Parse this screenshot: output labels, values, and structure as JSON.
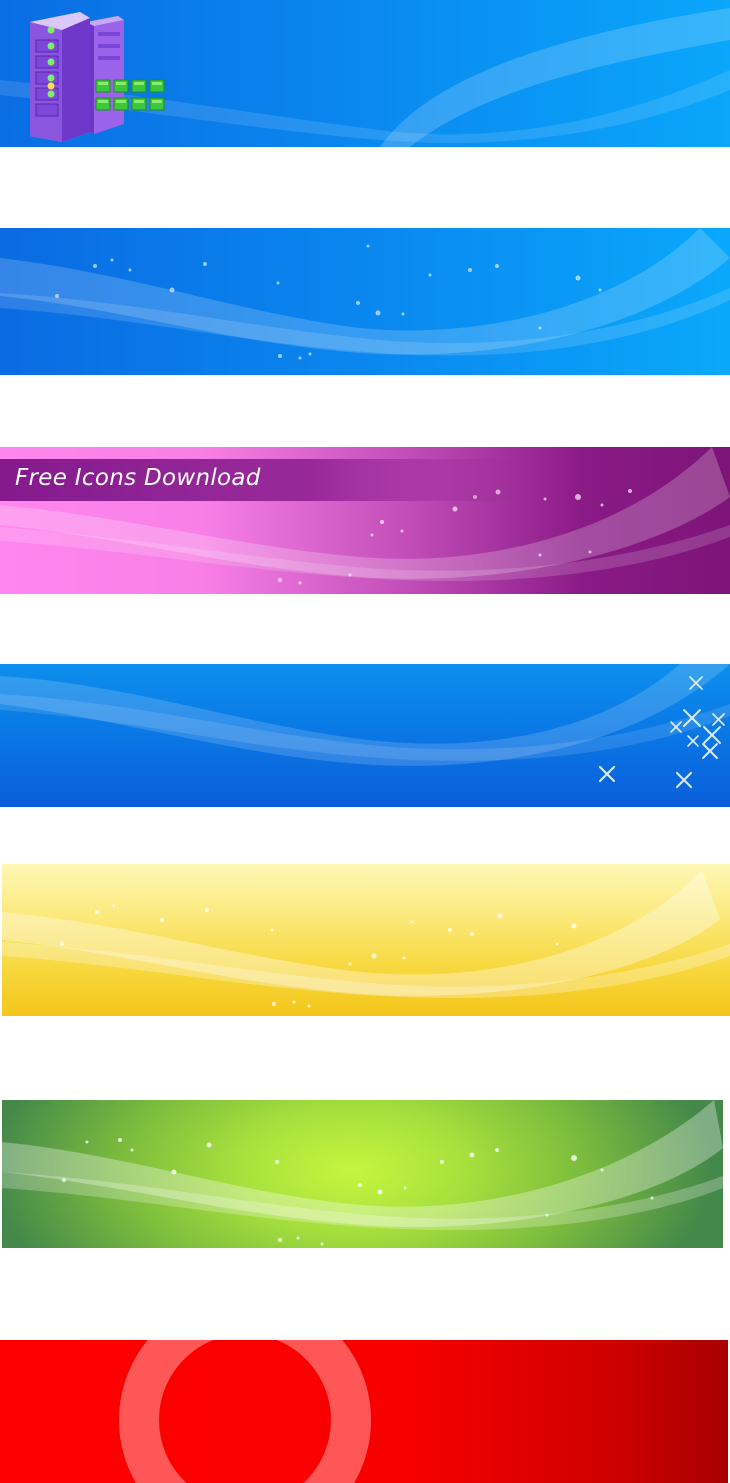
{
  "banners": [
    {
      "id": "blue-server-banner"
    },
    {
      "id": "blue-wave-banner"
    },
    {
      "id": "purple-title-banner",
      "title": "Free Icons Download"
    },
    {
      "id": "blue-sparkle-banner"
    },
    {
      "id": "yellow-wave-banner"
    },
    {
      "id": "green-wave-banner"
    },
    {
      "id": "red-ring-banner"
    }
  ],
  "colors": {
    "blue": "#0a86ee",
    "purple": "#8a1a86",
    "pink": "#ff86ee",
    "yellow": "#f7d73b",
    "green": "#7dbd3d",
    "red": "#ff0000"
  },
  "icons": [
    "server-icon",
    "sparkle-icon",
    "ring-shape"
  ]
}
